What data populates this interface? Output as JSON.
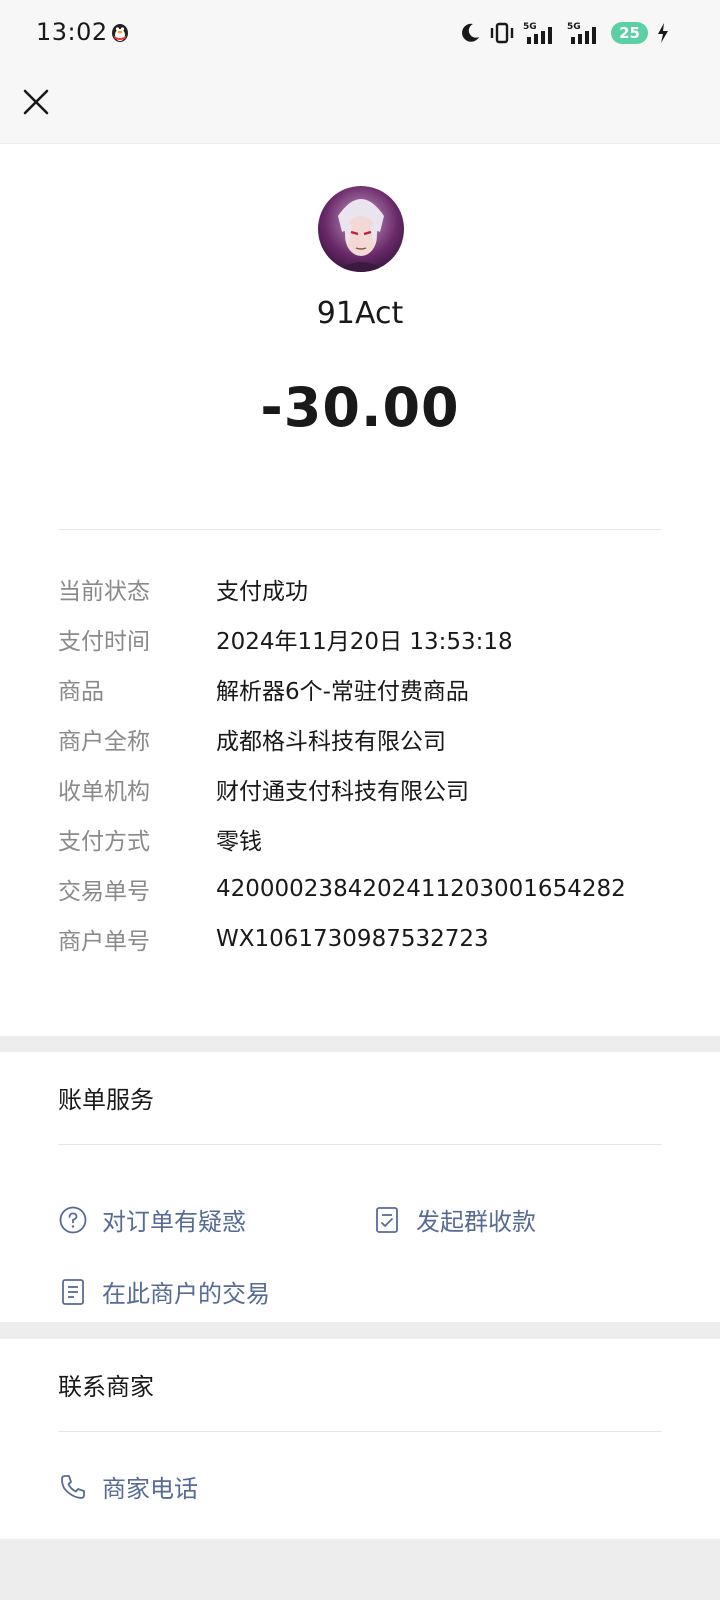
{
  "status_bar": {
    "time": "13:02",
    "battery": "25",
    "icons": [
      "qq-penguin-icon",
      "moon-icon",
      "vibrate-icon",
      "signal-5g-icon",
      "signal-5g-icon",
      "charging-icon"
    ]
  },
  "header": {
    "close_icon": "close-icon"
  },
  "summary": {
    "merchant_name": "91Act",
    "amount": "-30.00"
  },
  "details": [
    {
      "label": "当前状态",
      "value": "支付成功"
    },
    {
      "label": "支付时间",
      "value": "2024年11月20日 13:53:18"
    },
    {
      "label": "商品",
      "value": "解析器6个-常驻付费商品"
    },
    {
      "label": "商户全称",
      "value": "成都格斗科技有限公司"
    },
    {
      "label": "收单机构",
      "value": "财付通支付科技有限公司"
    },
    {
      "label": "支付方式",
      "value": "零钱"
    },
    {
      "label": "交易单号",
      "value": "4200002384202411203001654282"
    },
    {
      "label": "商户单号",
      "value": "WX1061730987532723"
    }
  ],
  "services": {
    "title": "账单服务",
    "items": [
      {
        "label": "对订单有疑惑",
        "icon": "question-circle-icon"
      },
      {
        "label": "发起群收款",
        "icon": "checklist-icon"
      },
      {
        "label": "在此商户的交易",
        "icon": "document-icon"
      }
    ]
  },
  "contact": {
    "title": "联系商家",
    "phone_label": "商家电话",
    "phone_icon": "phone-icon"
  },
  "colors": {
    "link": "#576b95",
    "background": "#ededed",
    "card": "#ffffff",
    "battery": "#5dcfa5"
  }
}
